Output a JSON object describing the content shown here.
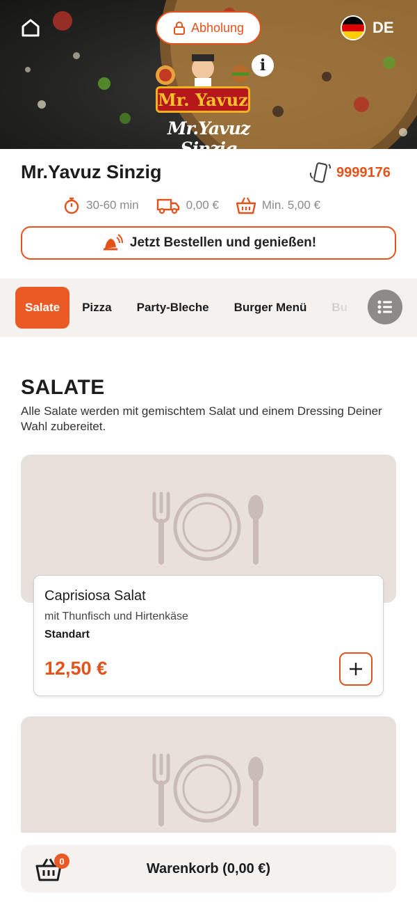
{
  "header": {
    "mode_label": "Abholung",
    "language": "DE",
    "logo_badge_text": "Mr. Yavuz",
    "logo_script_text": "Mr.Yavuz Sinzig"
  },
  "store": {
    "name": "Mr.Yavuz Sinzig",
    "phone": "9999176",
    "delivery_time": "30-60 min",
    "delivery_fee": "0,00 €",
    "min_order": "Min. 5,00 €",
    "cta_label": "Jetzt Bestellen und genießen!"
  },
  "categories": [
    "Salate",
    "Pizza",
    "Party-Bleche",
    "Burger Menü",
    "Bu"
  ],
  "active_category": "Salate",
  "section": {
    "title": "SALATE",
    "description": "Alle Salate werden mit gemischtem Salat und einem Dressing Deiner Wahl zubereitet."
  },
  "products": [
    {
      "name": "Caprisiosa Salat",
      "description": "mit Thunfisch und Hirtenkäse",
      "variant": "Standart",
      "price": "12,50 €"
    }
  ],
  "cart": {
    "count": "0",
    "label": "Warenkorb (0,00 €)"
  },
  "colors": {
    "accent": "#e4521c",
    "category_bar": "#f4f1ee",
    "placeholder_bg": "#e8e0db",
    "placeholder_icon": "#c9bcb6"
  },
  "icons": [
    "home-icon",
    "lock-icon",
    "info-icon",
    "phone-icon",
    "stopwatch-icon",
    "delivery-truck-icon",
    "basket-icon",
    "bell-icon",
    "list-icon",
    "fork-plate-spoon-icon",
    "cart-basket-icon"
  ]
}
